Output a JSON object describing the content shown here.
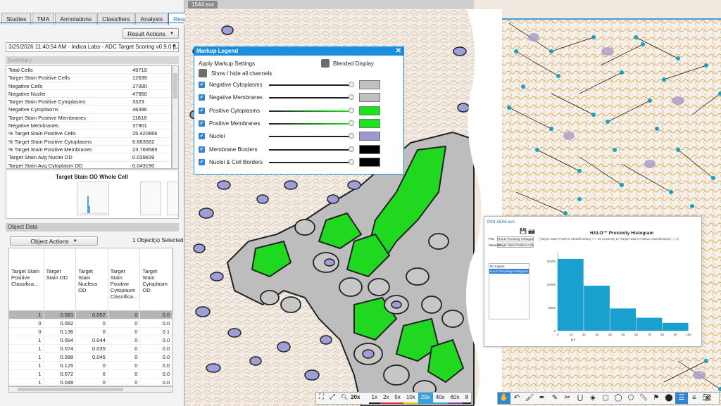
{
  "left_panel": {
    "tabs": [
      "Studies",
      "TMA",
      "Annotations",
      "Classifiers",
      "Analysis",
      "Results"
    ],
    "active_tab": "Results",
    "result_actions_label": "Result Actions",
    "analysis_run": "3/25/2026 11:40:54 AM - Indica Labs - ADC Target Scoring v0.9.0 [Layer 4]",
    "summary_title": "Summary",
    "summary_rows": [
      {
        "label": "Total Cells",
        "value": "49719"
      },
      {
        "label": "Target Stain Positive Cells",
        "value": "12639"
      },
      {
        "label": "Negative Cells",
        "value": "37080"
      },
      {
        "label": "Negative Nuclei",
        "value": "47950"
      },
      {
        "label": "Target Stain Positive Cytoplasms",
        "value": "3323"
      },
      {
        "label": "Negative Cytoplasms",
        "value": "46396"
      },
      {
        "label": "Target Stain Positive Membranes",
        "value": "11818"
      },
      {
        "label": "Negative Membranes",
        "value": "37901"
      },
      {
        "label": "% Target Stain Positive Cells",
        "value": "25.420866"
      },
      {
        "label": "% Target Stain Positive Cytoplasms",
        "value": "6.683562"
      },
      {
        "label": "% Target Stain Positive Membranes",
        "value": "23.769585"
      },
      {
        "label": "Target Stain Avg Nuclei OD",
        "value": "0.039839"
      },
      {
        "label": "Target Stain Avg Cytoplasm OD",
        "value": "0.043190"
      }
    ],
    "chart_title": "Target Stain OD Whole Cell",
    "object_data_title": "Object Data",
    "object_actions_label": "Object Actions",
    "selected_count": "1 Object(s) Selected",
    "object_columns": [
      "Target Stain Positive Classifica...",
      "Target Stain OD",
      "Target Stain Nucleus OD",
      "Target Stain Positive Cytoplasm Classifica...",
      "Target Stain Cytoplasm OD"
    ],
    "object_rows": [
      [
        "1",
        "0.081",
        "0.052",
        "0",
        "0.0"
      ],
      [
        "0",
        "0.082",
        "0",
        "0",
        "0.0"
      ],
      [
        "0",
        "0.136",
        "0",
        "0",
        "0.1"
      ],
      [
        "1",
        "0.094",
        "0.044",
        "0",
        "0.0"
      ],
      [
        "1",
        "0.074",
        "0.035",
        "0",
        "0.0"
      ],
      [
        "1",
        "0.088",
        "0.045",
        "0",
        "0.0"
      ],
      [
        "1",
        "0.125",
        "0",
        "0",
        "0.0"
      ],
      [
        "1",
        "0.072",
        "0",
        "0",
        "0.0"
      ],
      [
        "1",
        "0.048",
        "0",
        "0",
        "0.0"
      ]
    ],
    "selected_row_index": 0
  },
  "viewer": {
    "tab_name": "1544.svs",
    "markup_legend": {
      "title": "Markup Legend",
      "apply_settings": "Apply Markup Settings",
      "blended_display": "Blended Display",
      "show_hide": "Show / hide all channels",
      "channels": [
        {
          "name": "Negative Cytoplasms",
          "color": "#c0c0c0"
        },
        {
          "name": "Negative Membranes",
          "color": "#c0c0c0"
        },
        {
          "name": "Positive Cytoplasms",
          "color": "#19e619"
        },
        {
          "name": "Positive Membranes",
          "color": "#19e619"
        },
        {
          "name": "Nuclei",
          "color": "#9a9ad0"
        },
        {
          "name": "Membrane Borders",
          "color": "#000000"
        },
        {
          "name": "Nuclei & Cell Borders",
          "color": "#000000"
        }
      ]
    },
    "plot_window": {
      "tabs": "Plot   1544.svs",
      "title": "HALO™ Proximity Histogram",
      "subtitle": "(Target Stain Positive Classification) <-> 45 proximity to (Target Stain Positive Classification) -> 1)",
      "list_header": "No Layers",
      "list_item": "HALO Proximity Histogram Results",
      "field1_label": "Plot",
      "field1_value": "HALO Proximity Histogram",
      "field2_label": "Measure",
      "field2_value": "Target Stain Positive Cells",
      "chart_data": {
        "type": "bar",
        "categories": [
          "0-20",
          "20-40",
          "40-60",
          "60-80",
          "80-100"
        ],
        "values": [
          15500,
          9700,
          4800,
          2800,
          1700
        ],
        "xticks": [
          "0",
          "10",
          "20",
          "30",
          "40",
          "50",
          "60",
          "70",
          "80",
          "90",
          "100"
        ],
        "yticks": [
          "0",
          "5000",
          "10000",
          "15000"
        ],
        "xlabel": "µm",
        "ylim": [
          0,
          17000
        ],
        "xlim": [
          0,
          100
        ],
        "color": "#1aa0cf"
      }
    },
    "zoom_levels": [
      "1x",
      "2x",
      "5x",
      "10x",
      "20x",
      "40x",
      "60x",
      "8"
    ],
    "zoom_colors": [
      "#222222",
      "#d33",
      "#d33",
      "#e6c200",
      "#3aa0dc",
      "#3aa0dc",
      "#8040c0",
      "#222222"
    ],
    "active_zoom": "20x",
    "current_zoom": "20x"
  }
}
